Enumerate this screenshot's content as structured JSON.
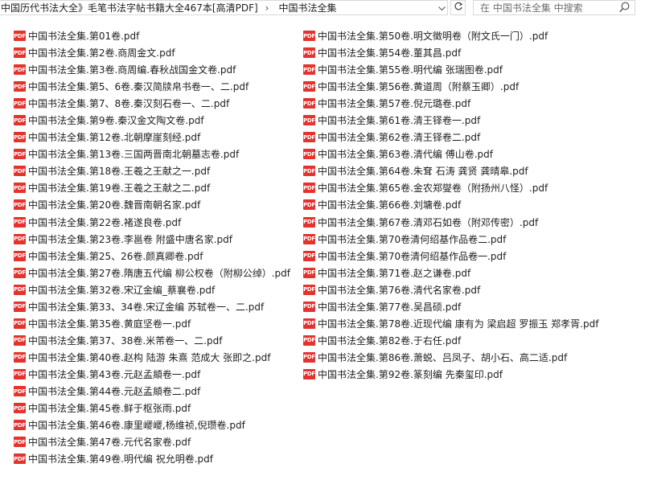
{
  "address_bar": {
    "breadcrumbs": [
      "中国历代书法大全》毛笔书法字帖书籍大全467本[高清PDF]",
      "中国书法全集"
    ]
  },
  "search": {
    "placeholder": "在 中国书法全集 中搜索"
  },
  "icons": {
    "pdf": "pdf-file-icon",
    "refresh": "refresh-icon",
    "search": "search-icon",
    "dropdown": "chevron-down-icon",
    "separator": "chevron-right-icon"
  },
  "pdf_label": "PDF",
  "files_left": [
    "中国书法全集.第01卷.pdf",
    "中国书法全集.第2卷.商周金文.pdf",
    "中国书法全集.第3卷.商周编.春秋战国金文卷.pdf",
    "中国书法全集.第5、6卷.秦汉简牍帛书卷一、二.pdf",
    "中国书法全集.第7、8卷.秦汉刻石卷一、二.pdf",
    "中国书法全集.第9卷.秦汉金文陶文卷.pdf",
    "中国书法全集.第12卷.北朝摩崖刻经.pdf",
    "中国书法全集.第13卷.三国两晋南北朝墓志卷.pdf",
    "中国书法全集.第18卷.王羲之王献之一.pdf",
    "中国书法全集.第19卷.王羲之王献之二.pdf",
    "中国书法全集.第20卷.魏晋南朝名家.pdf",
    "中国书法全集.第22卷.褚遂良卷.pdf",
    "中国书法全集.第23卷.李邕卷 附盛中唐名家.pdf",
    "中国书法全集.第25、26卷.颜真卿卷.pdf",
    "中国书法全集.第27卷.隋唐五代编 柳公权卷（附柳公绰）.pdf",
    "中国书法全集.第32卷.宋辽金编_蔡襄卷.pdf",
    "中国书法全集.第33、34卷.宋辽金编 苏轼卷一、二.pdf",
    "中国书法全集.第35卷.黄庭坚卷一.pdf",
    "中国书法全集.第37、38卷.米芾卷一、二.pdf",
    "中国书法全集.第40卷.赵构 陆游 朱熹 范成大 张即之.pdf",
    "中国书法全集.第43卷.元赵孟頫卷一.pdf",
    "中国书法全集.第44卷.元赵孟頫卷二.pdf",
    "中国书法全集.第45卷.鲜于枢张雨.pdf",
    "中国书法全集.第46卷.康里巎巎,杨维祯,倪瓒卷.pdf",
    "中国书法全集.第47卷.元代名家卷.pdf",
    "中国书法全集.第49卷.明代编 祝允明卷.pdf"
  ],
  "files_right": [
    "中国书法全集.第50卷.明文徵明卷（附文氏一门）.pdf",
    "中国书法全集.第54卷.董其昌.pdf",
    "中国书法全集.第55卷.明代编 张瑞图卷.pdf",
    "中国书法全集.第56卷.黄道周（附蔡玉卿）.pdf",
    "中国书法全集.第57卷.倪元璐卷.pdf",
    "中国书法全集.第61卷.清王铎卷一.pdf",
    "中国书法全集.第62卷.清王铎卷二.pdf",
    "中国书法全集.第63卷.清代编 傅山卷.pdf",
    "中国书法全集.第64卷.朱耷 石涛 龚贤 龚晴皋.pdf",
    "中国书法全集.第65卷.金农郑燮卷（附扬州八怪）.pdf",
    "中国书法全集.第66卷.刘墉卷.pdf",
    "中国书法全集.第67卷.清邓石如卷（附邓传密）.pdf",
    "中国书法全集.第70卷清何绍基作品卷二.pdf",
    "中国书法全集.第70卷清何绍基作品卷一.pdf",
    "中国书法全集.第71卷.赵之谦卷.pdf",
    "中国书法全集.第76卷.清代名家卷.pdf",
    "中国书法全集.第77卷.吴昌硕.pdf",
    "中国书法全集.第78卷.近现代编 康有为 梁启超 罗振玉 郑孝胥.pdf",
    "中国书法全集.第82卷.于右任.pdf",
    "中国书法全集.第86卷.萧蜕、吕凤子、胡小石、高二适.pdf",
    "中国书法全集.第92卷.篆刻编 先秦玺印.pdf"
  ]
}
